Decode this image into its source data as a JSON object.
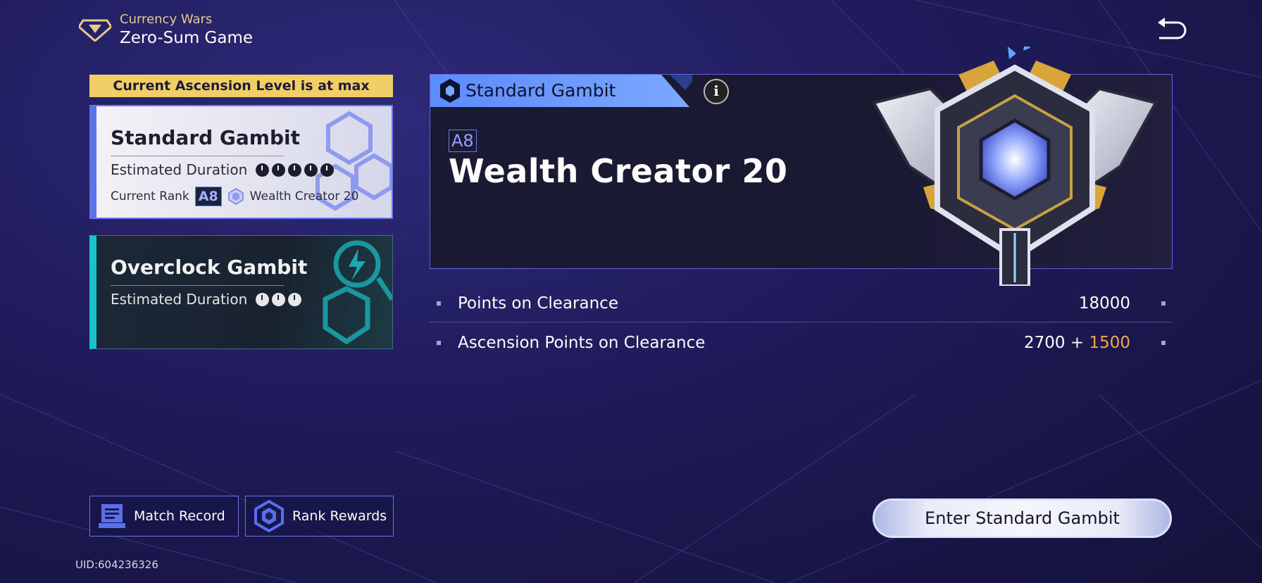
{
  "header": {
    "subtitle": "Currency Wars",
    "title": "Zero-Sum Game"
  },
  "left": {
    "ascension_banner": "Current Ascension Level is at max",
    "standard": {
      "title": "Standard Gambit",
      "duration_label": "Estimated Duration",
      "duration_clocks": 5,
      "rank_label": "Current Rank",
      "rank_badge": "A8",
      "rank_name": "Wealth Creator 20"
    },
    "overclock": {
      "title": "Overclock Gambit",
      "duration_label": "Estimated Duration",
      "duration_clocks": 3
    }
  },
  "buttons": {
    "match_record": "Match Record",
    "rank_rewards": "Rank Rewards",
    "enter": "Enter Standard Gambit"
  },
  "uid": "UID:604236326",
  "panel": {
    "tab_label": "Standard Gambit",
    "info_glyph": "i",
    "rank_badge": "A8",
    "rank_title": "Wealth Creator 20"
  },
  "stats": {
    "points_label": "Points on Clearance",
    "points_value": "18000",
    "ascension_label": "Ascension Points on Clearance",
    "ascension_base": "2700",
    "ascension_plus": "+",
    "ascension_bonus": "1500"
  },
  "colors": {
    "accent_gold": "#f2cf64",
    "accent_orange": "#f4a64a",
    "standard_blue": "#5d71e8",
    "overclock_teal": "#19c4c8"
  },
  "icons": {
    "header": "diamond-icon",
    "back": "back-arrow-icon",
    "match_record": "record-icon",
    "rank_rewards": "rank-reward-icon",
    "tab": "hexagon-icon",
    "rank_gem": "gem-icon"
  }
}
